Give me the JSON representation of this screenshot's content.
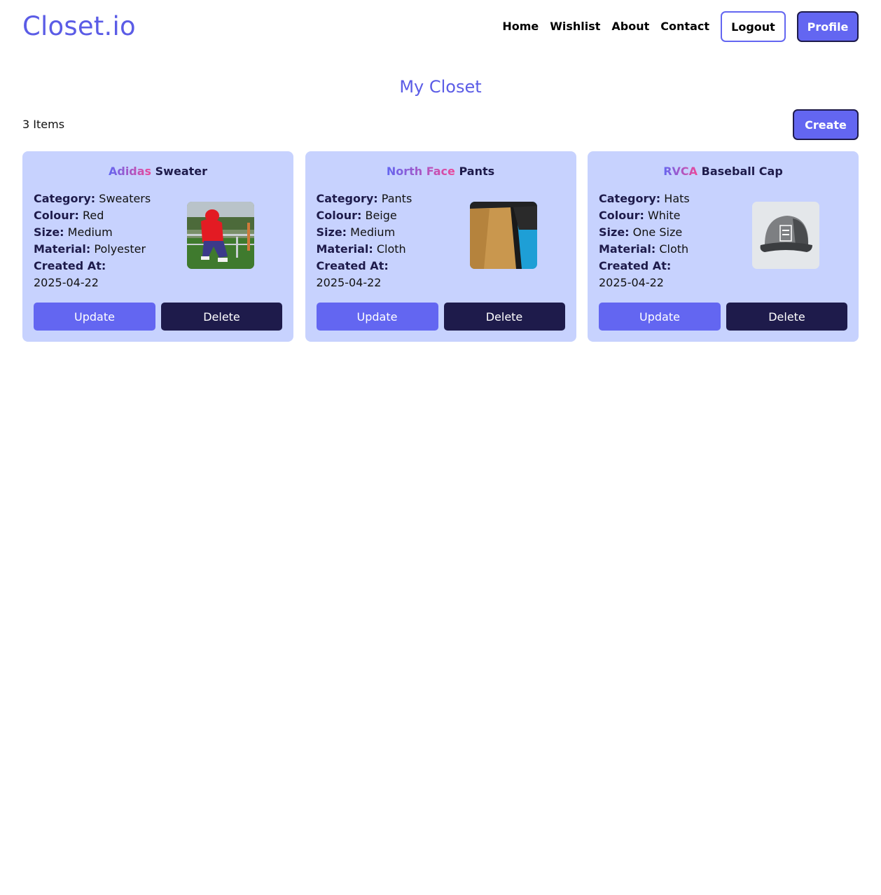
{
  "app": {
    "logo": "Closet.io"
  },
  "nav": {
    "links": [
      "Home",
      "Wishlist",
      "About",
      "Contact"
    ],
    "logout_label": "Logout",
    "profile_label": "Profile"
  },
  "page": {
    "title": "My Closet",
    "item_count": "3 Items",
    "create_label": "Create"
  },
  "labels": {
    "category": "Category:",
    "colour": "Colour:",
    "size": "Size:",
    "material": "Material:",
    "created_at": "Created At:"
  },
  "items": [
    {
      "brand": "Adidas",
      "name": "Sweater",
      "category": "Sweaters",
      "colour": "Red",
      "size": "Medium",
      "material": "Polyester",
      "created_at": "2025-04-22",
      "image": "person-red-adidas-sweater-photo",
      "update_label": "Update",
      "delete_label": "Delete"
    },
    {
      "brand": "North Face",
      "name": "Pants",
      "category": "Pants",
      "colour": "Beige",
      "size": "Medium",
      "material": "Cloth",
      "created_at": "2025-04-22",
      "image": "beige-pants-photo",
      "update_label": "Update",
      "delete_label": "Delete"
    },
    {
      "brand": "RVCA",
      "name": "Baseball Cap",
      "category": "Hats",
      "colour": "White",
      "size": "One Size",
      "material": "Cloth",
      "created_at": "2025-04-22",
      "image": "grey-rvca-cap-photo",
      "update_label": "Update",
      "delete_label": "Delete"
    }
  ],
  "colors": {
    "accent": "#6366f1",
    "dark": "#1e1b4b",
    "card_bg": "#c7d2fe",
    "brand_gradient_end": "#ec4899"
  }
}
